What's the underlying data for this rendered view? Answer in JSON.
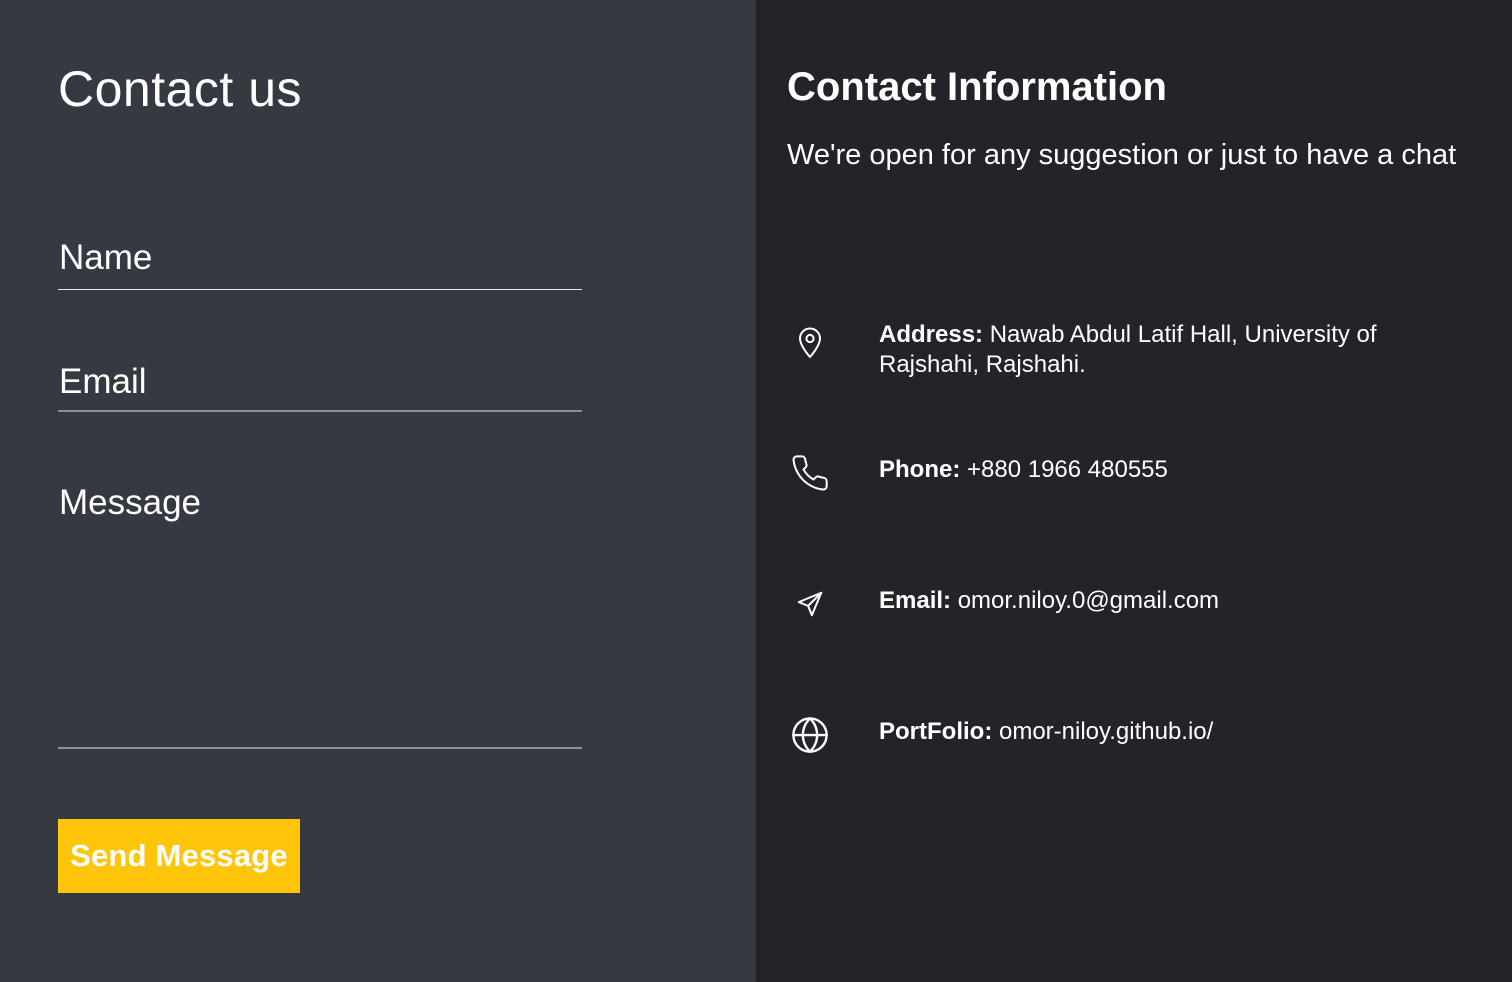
{
  "contact_form": {
    "title": "Contact us",
    "name_label": "Name",
    "email_label": "Email",
    "message_label": "Message",
    "submit_label": "Send Message",
    "button_color": "#ffc50b",
    "background_color": "#353941"
  },
  "contact_info": {
    "title": "Contact Information",
    "subtitle": "We're open for any suggestion or just to have a chat",
    "background_color": "#222429",
    "items": [
      {
        "icon": "location-pin-icon",
        "key": "Address:",
        "value": "Nawab Abdul Latif Hall, University of Rajshahi, Rajshahi."
      },
      {
        "icon": "phone-icon",
        "key": "Phone:",
        "value": "+880 1966 480555"
      },
      {
        "icon": "send-icon",
        "key": "Email:",
        "value": "omor.niloy.0@gmail.com"
      },
      {
        "icon": "globe-icon",
        "key": "PortFolio:",
        "value": "omor-niloy.github.io/"
      }
    ]
  }
}
